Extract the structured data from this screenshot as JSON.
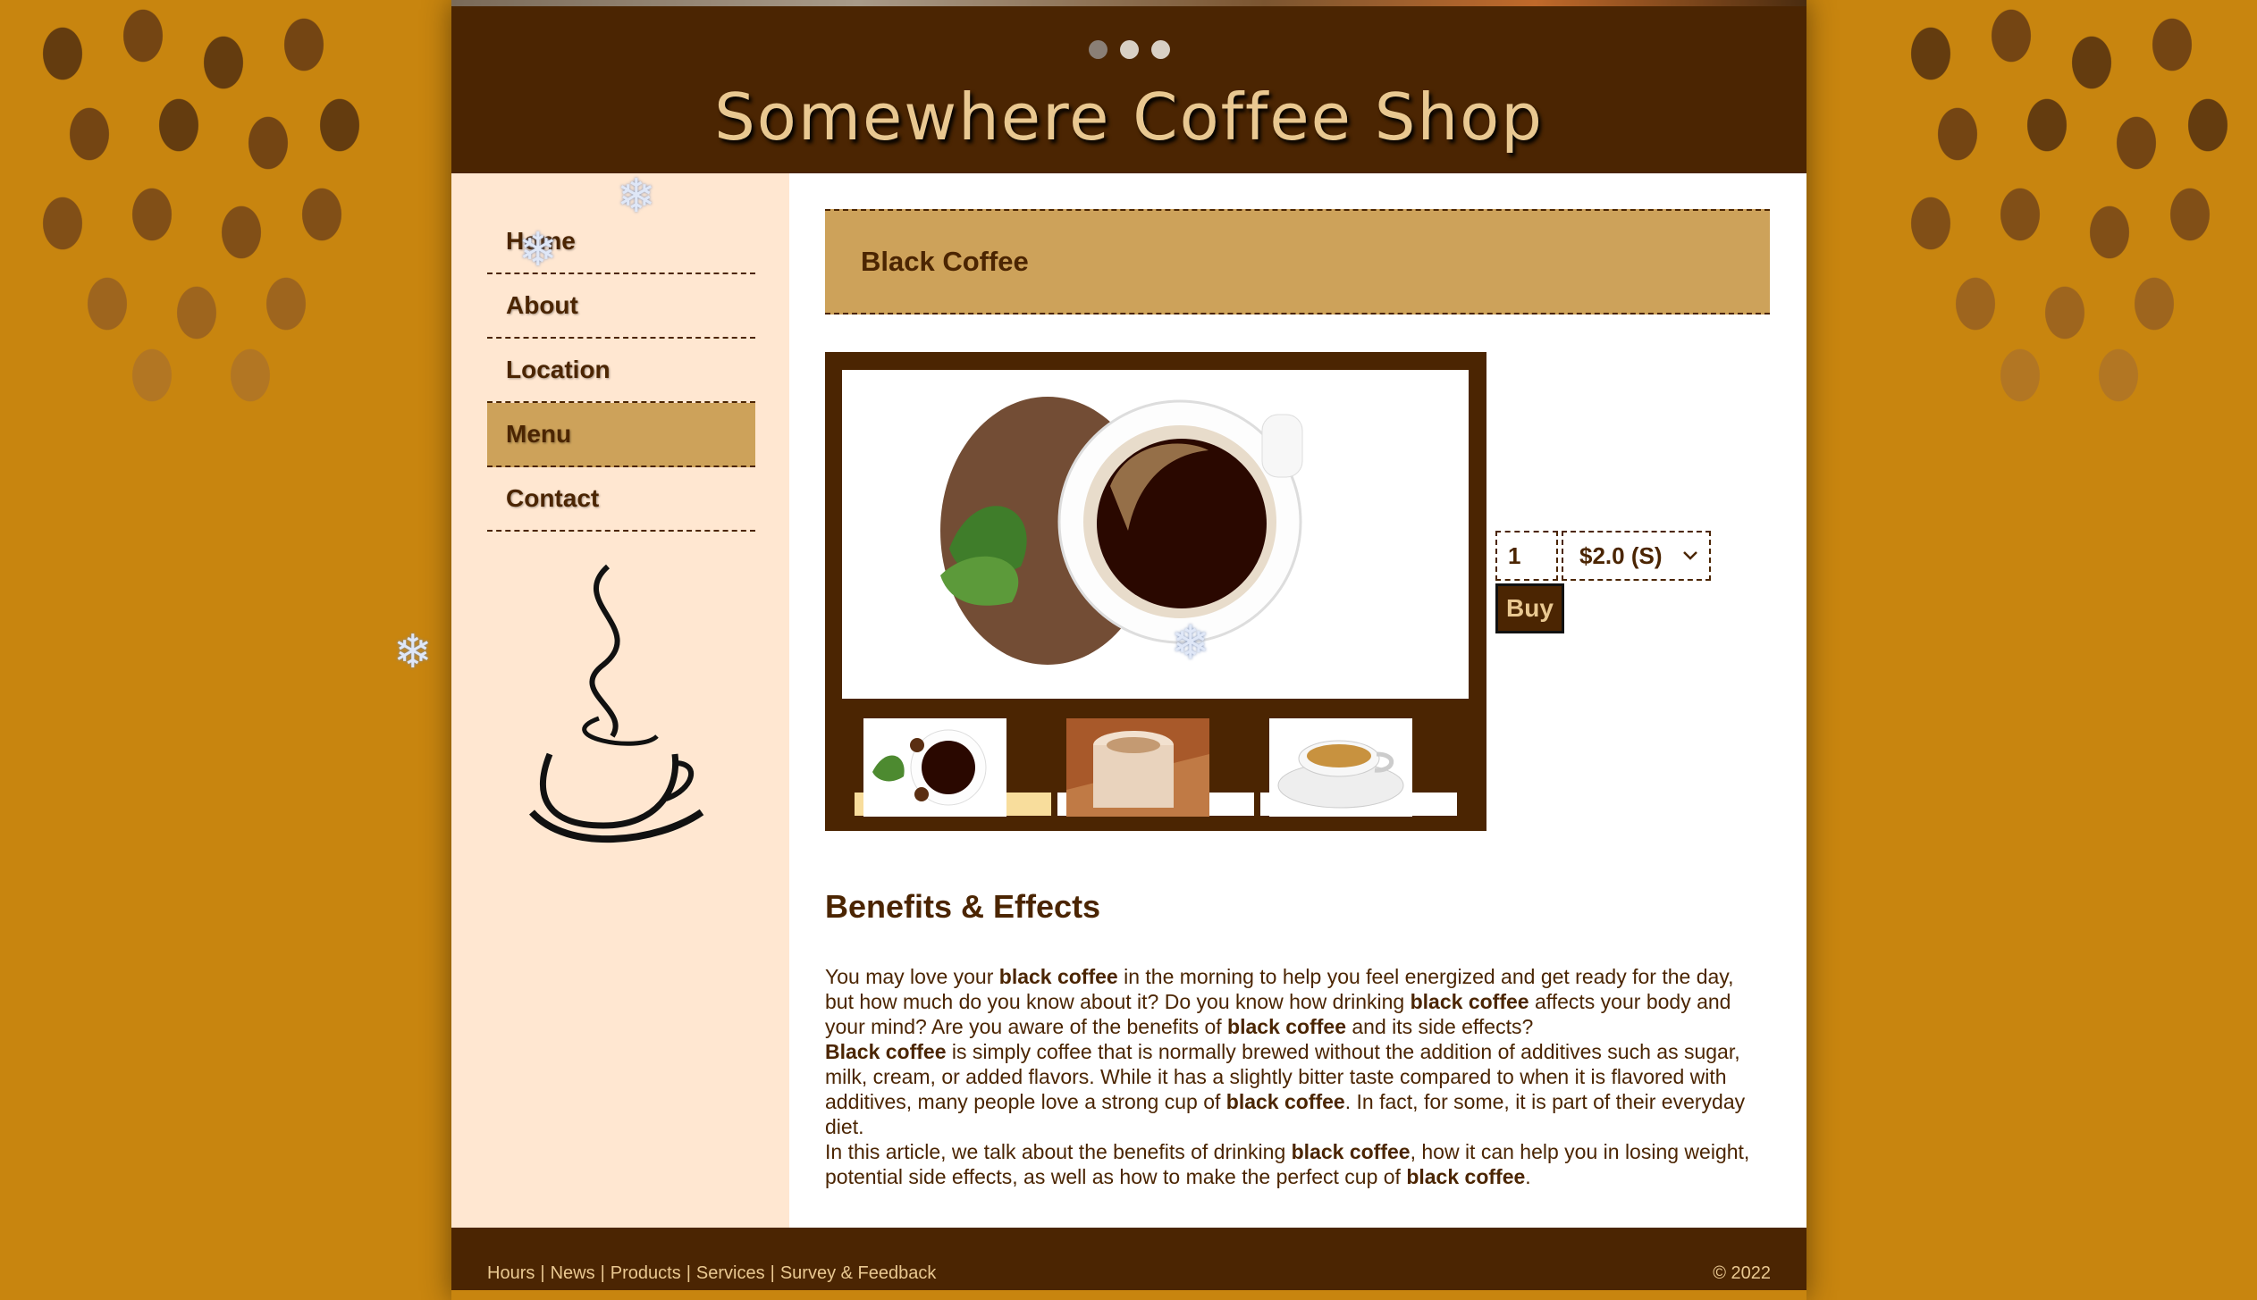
{
  "site": {
    "title": "Somewhere Coffee Shop",
    "slides": 3,
    "active_slide": 1
  },
  "nav": {
    "items": [
      {
        "label": "Home"
      },
      {
        "label": "About"
      },
      {
        "label": "Location"
      },
      {
        "label": "Menu"
      },
      {
        "label": "Contact"
      }
    ],
    "active": "Menu"
  },
  "product": {
    "name": "Black Coffee",
    "quantity": "1",
    "size_option": "$2.0 (S)",
    "buy_label": "Buy",
    "thumbnails": [
      "black-coffee-thumb",
      "latte-thumb",
      "espresso-cup-thumb"
    ],
    "active_thumbnail": 0
  },
  "article": {
    "heading": "Benefits & Effects",
    "p1_a": "You may love your ",
    "p1_b": "black coffee",
    "p1_c": " in the morning to help you feel energized and get ready for the day, but how much do you know about it? Do you know how drinking ",
    "p1_d": "black coffee",
    "p1_e": " affects your body and your mind? Are you aware of the benefits of ",
    "p1_f": "black coffee",
    "p1_g": " and its side effects?",
    "p2_a": "Black coffee",
    "p2_b": " is simply coffee that is normally brewed without the addition of additives such as sugar, milk, cream, or added flavors. While it has a slightly bitter taste compared to when it is flavored with additives, many people love a strong cup of ",
    "p2_c": "black coffee",
    "p2_d": ". In fact, for some, it is part of their everyday diet.",
    "p3_a": "In this article, we talk about the benefits of drinking ",
    "p3_b": "black coffee",
    "p3_c": ", how it can help you in losing weight, potential side effects, as well as how to make the perfect cup of ",
    "p3_d": "black coffee",
    "p3_e": "."
  },
  "footer": {
    "links": [
      "Hours",
      "News",
      "Products",
      "Services",
      "Survey & Feedback"
    ],
    "separator": "|",
    "copyright": "© 2022"
  },
  "colors": {
    "background": "#c8850f",
    "dark_brown": "#4b2502",
    "tan": "#cda25a",
    "sidebar": "#ffe7d1",
    "gold_text": "#e9c891"
  }
}
